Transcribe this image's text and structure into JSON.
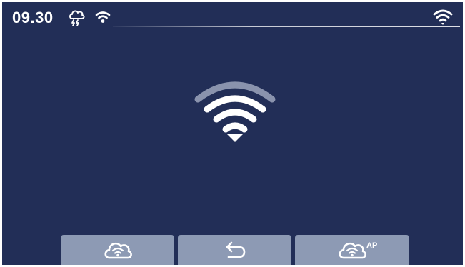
{
  "status_bar": {
    "time": "09.30",
    "weather_icon": "cloud-thunder-icon",
    "wifi_icon": "wifi-icon",
    "signal_icon": "wifi-icon"
  },
  "main": {
    "connection_icon": "wifi-large-icon"
  },
  "bottom_bar": {
    "buttons": [
      {
        "icon": "cloud-wifi-icon"
      },
      {
        "icon": "back-arrow-icon"
      },
      {
        "icon": "cloud-wifi-icon",
        "badge": "AP"
      }
    ]
  },
  "colors": {
    "background": "#222e57",
    "button": "#8d9ab4",
    "foreground": "#ffffff",
    "wifi_outer_arc": "#8a93ad"
  }
}
